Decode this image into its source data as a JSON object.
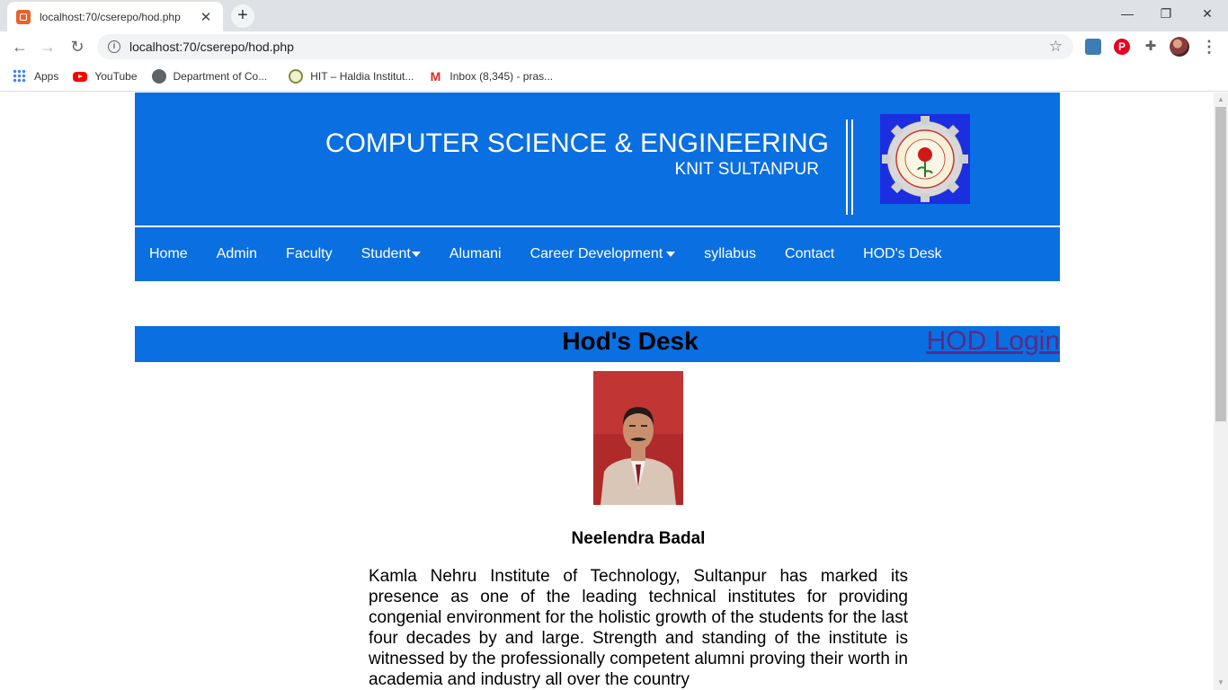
{
  "browser": {
    "tab_title": "localhost:70/cserepo/hod.php",
    "tab_close": "✕",
    "new_tab": "+",
    "url": "localhost:70/cserepo/hod.php",
    "controls": {
      "minimize": "—",
      "restore": "❐",
      "close": "✕"
    },
    "nav": {
      "back": "←",
      "forward": "→",
      "reload": "↻"
    },
    "bookmarks": [
      {
        "label": "Apps",
        "icon": "apps-icon"
      },
      {
        "label": "YouTube",
        "icon": "youtube-icon"
      },
      {
        "label": "Department of Co...",
        "icon": "globe-icon"
      },
      {
        "label": "HIT – Haldia Institut...",
        "icon": "hit-icon"
      },
      {
        "label": "Inbox (8,345) - pras...",
        "icon": "gmail-icon"
      }
    ]
  },
  "header": {
    "title": "COMPUTER SCIENCE & ENGINEERING",
    "subtitle": "KNIT SULTANPUR"
  },
  "nav": {
    "items": [
      {
        "label": "Home"
      },
      {
        "label": "Admin"
      },
      {
        "label": "Faculty"
      },
      {
        "label": "Student",
        "dropdown": true
      },
      {
        "label": "Alumani"
      },
      {
        "label": "Career Development",
        "dropdown": true
      },
      {
        "label": "syllabus"
      },
      {
        "label": "Contact"
      },
      {
        "label": "HOD's Desk"
      }
    ]
  },
  "desk": {
    "title": "Hod's Desk",
    "login_link": "HOD Login"
  },
  "hod": {
    "name": "Neelendra Badal",
    "message": "Kamla Nehru Institute of Technology, Sultanpur has marked its presence as one of the leading technical institutes for providing congenial environment for the holistic growth of the students for the last four decades by and large. Strength and standing of the institute is witnessed by the professionally competent alumni proving their worth in academia and industry all over the country"
  },
  "colors": {
    "primary": "#0a6fe0",
    "link_visited": "#5a2a86"
  }
}
